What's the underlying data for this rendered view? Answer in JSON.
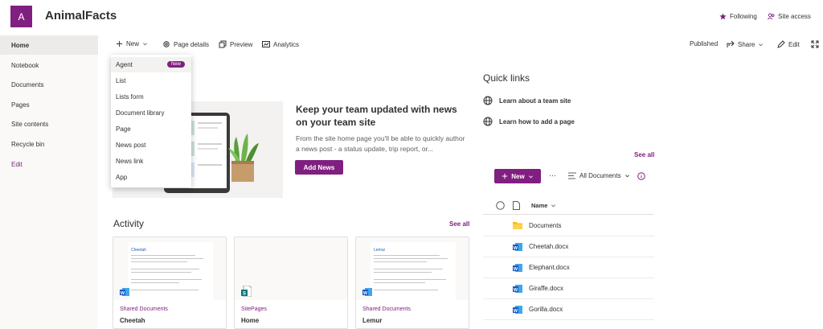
{
  "header": {
    "site_initial": "A",
    "site_title": "AnimalFacts",
    "following_label": "Following",
    "site_access_label": "Site access"
  },
  "leftnav": {
    "items": [
      {
        "label": "Home"
      },
      {
        "label": "Notebook"
      },
      {
        "label": "Documents"
      },
      {
        "label": "Pages"
      },
      {
        "label": "Site contents"
      },
      {
        "label": "Recycle bin"
      },
      {
        "label": "Edit"
      }
    ]
  },
  "commandbar": {
    "new_label": "New",
    "page_details_label": "Page details",
    "preview_label": "Preview",
    "analytics_label": "Analytics",
    "published_label": "Published",
    "share_label": "Share",
    "edit_label": "Edit"
  },
  "new_menu": {
    "items": [
      {
        "label": "Agent"
      },
      {
        "label": "List"
      },
      {
        "label": "Lists form"
      },
      {
        "label": "Document library"
      },
      {
        "label": "Page"
      },
      {
        "label": "News post"
      },
      {
        "label": "News link"
      },
      {
        "label": "App"
      }
    ],
    "badge": "New"
  },
  "news": {
    "title": "Keep your team updated with news on your team site",
    "description": "From the site home page you'll be able to quickly author a news post - a status update, trip report, or...",
    "add_button": "Add News"
  },
  "activity": {
    "title": "Activity",
    "see_all": "See all",
    "cards": [
      {
        "library": "Shared Documents",
        "name": "Cheetah",
        "preview_heading": "Cheetah"
      },
      {
        "library": "SitePages",
        "name": "Home",
        "preview_heading": ""
      },
      {
        "library": "Shared Documents",
        "name": "Lemur",
        "preview_heading": "Lemur"
      }
    ]
  },
  "quick_links": {
    "title": "Quick links",
    "items": [
      {
        "label": "Learn about a team site"
      },
      {
        "label": "Learn how to add a page"
      }
    ]
  },
  "documents": {
    "see_all": "See all",
    "new_label": "New",
    "more_label": "···",
    "view_label": "All Documents",
    "name_header": "Name",
    "files": [
      {
        "name": "Documents",
        "type": "folder"
      },
      {
        "name": "Cheetah.docx",
        "type": "docx"
      },
      {
        "name": "Elephant.docx",
        "type": "docx"
      },
      {
        "name": "Giraffe.docx",
        "type": "docx"
      },
      {
        "name": "Gorilla.docx",
        "type": "docx"
      }
    ]
  },
  "colors": {
    "brand": "#801f80",
    "word_blue": "#185abd",
    "folder_yellow": "#ffb900"
  }
}
